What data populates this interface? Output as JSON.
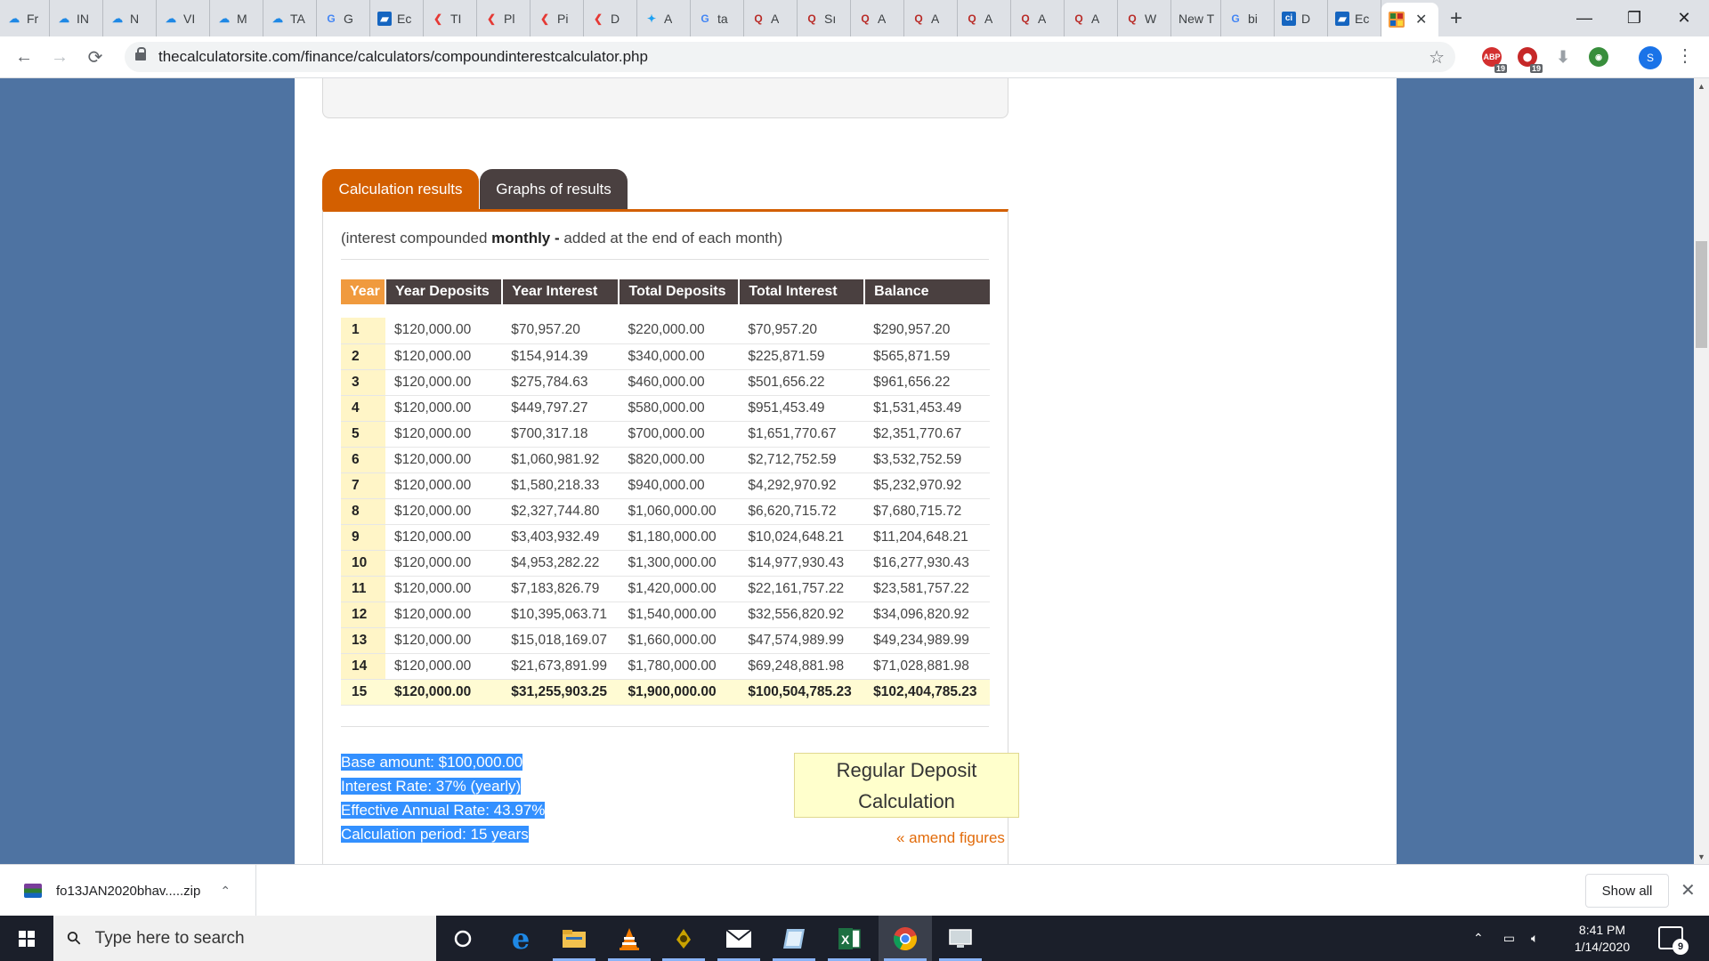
{
  "browser": {
    "tabs": [
      {
        "label": "Fr",
        "icon": "cloud-icon",
        "color": "#1e88e5"
      },
      {
        "label": "IN",
        "icon": "cloud-icon",
        "color": "#1e88e5"
      },
      {
        "label": "N",
        "icon": "cloud-icon",
        "color": "#1e88e5"
      },
      {
        "label": "VI",
        "icon": "cloud-icon",
        "color": "#1e88e5"
      },
      {
        "label": "M",
        "icon": "cloud-icon",
        "color": "#1e88e5"
      },
      {
        "label": "TA",
        "icon": "cloud-icon",
        "color": "#1e88e5"
      },
      {
        "label": "G",
        "icon": "google-icon",
        "color": "#4285f4"
      },
      {
        "label": "Ec",
        "icon": "doc-icon",
        "color": "#1565c0"
      },
      {
        "label": "TI",
        "icon": "chevron-left-icon",
        "color": "#e53935"
      },
      {
        "label": "Pl",
        "icon": "chevron-left-icon",
        "color": "#e53935"
      },
      {
        "label": "Pi",
        "icon": "chevron-left-icon",
        "color": "#e53935"
      },
      {
        "label": "D",
        "icon": "chevron-left-icon",
        "color": "#e53935"
      },
      {
        "label": "A",
        "icon": "twitter-icon",
        "color": "#1da1f2"
      },
      {
        "label": "ta",
        "icon": "google-icon",
        "color": "#4285f4"
      },
      {
        "label": "A",
        "icon": "quora-icon",
        "color": "#b92b27"
      },
      {
        "label": "Sı",
        "icon": "quora-icon",
        "color": "#b92b27"
      },
      {
        "label": "A",
        "icon": "quora-icon",
        "color": "#b92b27"
      },
      {
        "label": "A",
        "icon": "quora-icon",
        "color": "#b92b27"
      },
      {
        "label": "A",
        "icon": "quora-icon",
        "color": "#b92b27"
      },
      {
        "label": "A",
        "icon": "quora-icon",
        "color": "#b92b27"
      },
      {
        "label": "A",
        "icon": "quora-icon",
        "color": "#b92b27"
      },
      {
        "label": "W",
        "icon": "quora-icon",
        "color": "#b92b27"
      },
      {
        "label": "New T",
        "icon": "",
        "color": ""
      },
      {
        "label": "bi",
        "icon": "google-icon",
        "color": "#4285f4"
      },
      {
        "label": "D",
        "icon": "ci-icon",
        "color": "#1565c0"
      },
      {
        "label": "Ec",
        "icon": "doc-icon",
        "color": "#1565c0"
      }
    ],
    "new_tab": "+",
    "minimize": "—",
    "maximize": "❐",
    "close": "✕",
    "url": "thecalculatorsite.com/finance/calculators/compoundinterestcalculator.php",
    "extension_badges": [
      "19",
      "19"
    ],
    "profile_initial": "S"
  },
  "page": {
    "tabs": {
      "calc": "Calculation results",
      "graph": "Graphs of results"
    },
    "note_prefix": "(interest compounded ",
    "note_bold": "monthly -",
    "note_suffix": " added at the end of each month)",
    "table": {
      "headers": [
        "Year",
        "Year Deposits",
        "Year Interest",
        "Total Deposits",
        "Total Interest",
        "Balance"
      ],
      "rows": [
        [
          "1",
          "$120,000.00",
          "$70,957.20",
          "$220,000.00",
          "$70,957.20",
          "$290,957.20"
        ],
        [
          "2",
          "$120,000.00",
          "$154,914.39",
          "$340,000.00",
          "$225,871.59",
          "$565,871.59"
        ],
        [
          "3",
          "$120,000.00",
          "$275,784.63",
          "$460,000.00",
          "$501,656.22",
          "$961,656.22"
        ],
        [
          "4",
          "$120,000.00",
          "$449,797.27",
          "$580,000.00",
          "$951,453.49",
          "$1,531,453.49"
        ],
        [
          "5",
          "$120,000.00",
          "$700,317.18",
          "$700,000.00",
          "$1,651,770.67",
          "$2,351,770.67"
        ],
        [
          "6",
          "$120,000.00",
          "$1,060,981.92",
          "$820,000.00",
          "$2,712,752.59",
          "$3,532,752.59"
        ],
        [
          "7",
          "$120,000.00",
          "$1,580,218.33",
          "$940,000.00",
          "$4,292,970.92",
          "$5,232,970.92"
        ],
        [
          "8",
          "$120,000.00",
          "$2,327,744.80",
          "$1,060,000.00",
          "$6,620,715.72",
          "$7,680,715.72"
        ],
        [
          "9",
          "$120,000.00",
          "$3,403,932.49",
          "$1,180,000.00",
          "$10,024,648.21",
          "$11,204,648.21"
        ],
        [
          "10",
          "$120,000.00",
          "$4,953,282.22",
          "$1,300,000.00",
          "$14,977,930.43",
          "$16,277,930.43"
        ],
        [
          "11",
          "$120,000.00",
          "$7,183,826.79",
          "$1,420,000.00",
          "$22,161,757.22",
          "$23,581,757.22"
        ],
        [
          "12",
          "$120,000.00",
          "$10,395,063.71",
          "$1,540,000.00",
          "$32,556,820.92",
          "$34,096,820.92"
        ],
        [
          "13",
          "$120,000.00",
          "$15,018,169.07",
          "$1,660,000.00",
          "$47,574,989.99",
          "$49,234,989.99"
        ],
        [
          "14",
          "$120,000.00",
          "$21,673,891.99",
          "$1,780,000.00",
          "$69,248,881.98",
          "$71,028,881.98"
        ],
        [
          "15",
          "$120,000.00",
          "$31,255,903.25",
          "$1,900,000.00",
          "$100,504,785.23",
          "$102,404,785.23"
        ]
      ]
    },
    "summary": [
      "Base amount: $100,000.00",
      "Interest Rate: 37% (yearly)",
      "Effective Annual Rate: 43.97%",
      "Calculation period: 15 years"
    ],
    "calc_type_line1": "Regular Deposit",
    "calc_type_line2": "Calculation",
    "amend_link": "« amend figures"
  },
  "downloads": {
    "file": "fo13JAN2020bhav.....zip",
    "show_all": "Show all"
  },
  "taskbar": {
    "search_placeholder": "Type here to search",
    "time": "8:41 PM",
    "date": "1/14/2020",
    "notifications": "9"
  }
}
